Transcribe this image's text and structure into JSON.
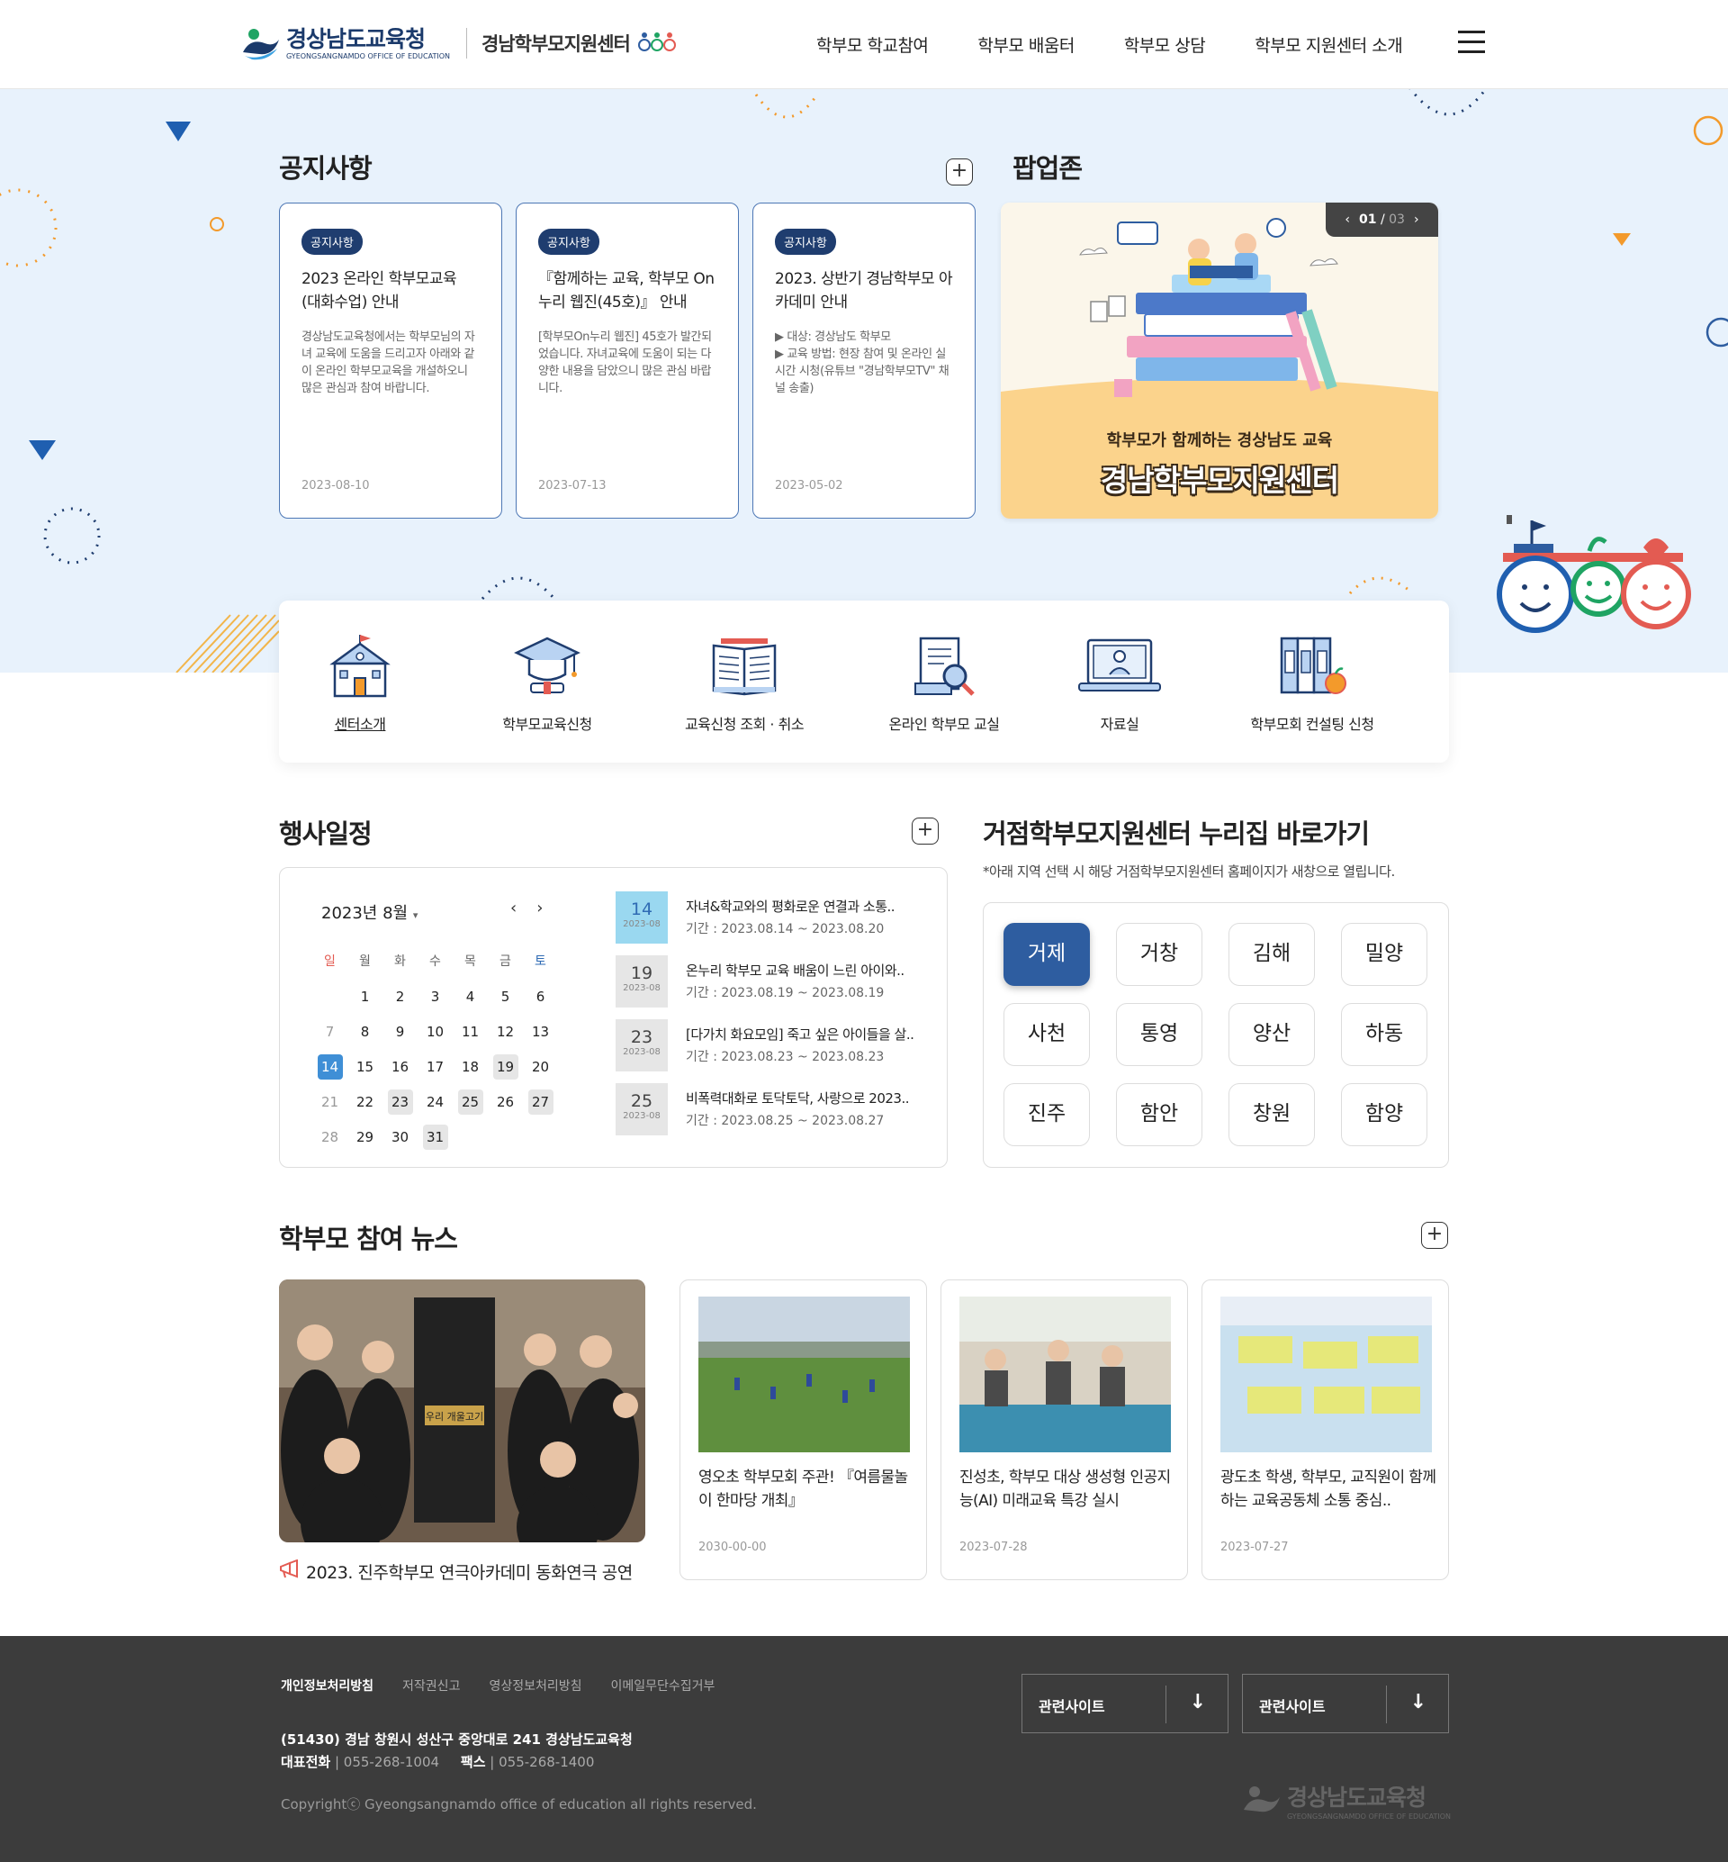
{
  "header": {
    "logo_ko": "경상남도교육청",
    "logo_en": "GYEONGSANGNAMDO OFFICE OF EDUCATION",
    "site_name": "경남학부모지원센터",
    "nav": [
      "학부모 학교참여",
      "학부모 배움터",
      "학부모 상담",
      "학부모 지원센터 소개"
    ],
    "menu_icon": "hamburger-icon"
  },
  "notice": {
    "title": "공지사항",
    "plus": "+",
    "cards": [
      {
        "badge": "공지사항",
        "title": "2023 온라인 학부모교육 (대화수업) 안내",
        "body": "경상남도교육청에서는 학부모님의 자녀 교육에 도움을 드리고자 아래와 같이 온라인 학부모교육을 개설하오니 많은 관심과 참여 바랍니다.",
        "date": "2023-08-10"
      },
      {
        "badge": "공지사항",
        "title": "『함께하는 교육, 학부모 On누리 웹진(45호)』 안내",
        "body": "[학부모On누리 웹진] 45호가 발간되었습니다. 자녀교육에 도움이 되는 다양한 내용을 담았으니 많은 관심 바랍니다.",
        "date": "2023-07-13"
      },
      {
        "badge": "공지사항",
        "title": "2023. 상반기 경남학부모 아카데미 안내",
        "body": "▶ 대상: 경상남도 학부모\n▶ 교육 방법: 현장 참여 및 온라인 실시간 시청(유튜브 \"경남학부모TV\" 채널 송출)",
        "date": "2023-05-02"
      }
    ]
  },
  "popup": {
    "title": "팝업존",
    "current": "01",
    "total": "03",
    "caption_small": "학부모가 함께하는 경상남도 교육",
    "caption_big": "경남학부모지원센터"
  },
  "quick_menu": [
    {
      "label": "센터소개",
      "icon": "school-building-icon"
    },
    {
      "label": "학부모교육신청",
      "icon": "graduation-cap-icon"
    },
    {
      "label": "교육신청 조회 · 취소",
      "icon": "open-book-icon"
    },
    {
      "label": "온라인 학부모 교실",
      "icon": "document-search-icon"
    },
    {
      "label": "자료실",
      "icon": "laptop-icon"
    },
    {
      "label": "학부모회 컨설팅 신청",
      "icon": "books-apple-icon"
    }
  ],
  "events": {
    "title": "행사일정",
    "plus": "+",
    "calendar": {
      "month_label": "2023년 8월",
      "dow": [
        "일",
        "월",
        "화",
        "수",
        "목",
        "금",
        "토"
      ],
      "weeks": [
        [
          "",
          "1",
          "2",
          "3",
          "4",
          "5",
          "6"
        ],
        [
          "7",
          "8",
          "9",
          "10",
          "11",
          "12",
          "13"
        ],
        [
          "14",
          "15",
          "16",
          "17",
          "18",
          "19",
          "20"
        ],
        [
          "21",
          "22",
          "23",
          "24",
          "25",
          "26",
          "27"
        ],
        [
          "28",
          "29",
          "30",
          "31",
          "",
          "",
          ""
        ]
      ],
      "today": "14",
      "event_days": [
        "19",
        "23",
        "25",
        "27",
        "31"
      ]
    },
    "list": [
      {
        "day": "14",
        "month": "2023-08",
        "title": "자녀&학교와의 평화로운 연결과 소통..",
        "period": "기간 : 2023.08.14 ~ 2023.08.20"
      },
      {
        "day": "19",
        "month": "2023-08",
        "title": "온누리 학부모 교육 배움이 느린 아이와..",
        "period": "기간 : 2023.08.19 ~ 2023.08.19"
      },
      {
        "day": "23",
        "month": "2023-08",
        "title": "[다가치 화요모임] 죽고 싶은 아이들을 살..",
        "period": "기간 : 2023.08.23 ~ 2023.08.23"
      },
      {
        "day": "25",
        "month": "2023-08",
        "title": "비폭력대화로 토닥토닥, 사랑으로 2023..",
        "period": "기간 : 2023.08.25 ~ 2023.08.27"
      }
    ]
  },
  "regions": {
    "title": "거점학부모지원센터 누리집 바로가기",
    "note": "*아래 지역 선택 시 해당 거점학부모지원센터 홈페이지가 새창으로 열립니다.",
    "items": [
      "거제",
      "거창",
      "김해",
      "밀양",
      "사천",
      "통영",
      "양산",
      "하동",
      "진주",
      "함안",
      "창원",
      "함양"
    ],
    "active": "거제"
  },
  "news": {
    "title": "학부모 참여 뉴스",
    "plus": "+",
    "main_caption": "2023. 진주학부모 연극아카데미 동화연극 공연",
    "main_poster": "우리 개울고기",
    "cards": [
      {
        "title": "영오초 학부모회 주관! 『여름물놀이 한마당 개최』",
        "date": "2030-00-00"
      },
      {
        "title": "진성초, 학부모 대상 생성형 인공지능(AI) 미래교육 특강 실시",
        "date": "2023-07-28"
      },
      {
        "title": "광도초 학생, 학부모, 교직원이 함께하는 교육공동체 소통 중심..",
        "date": "2023-07-27"
      }
    ]
  },
  "footer": {
    "links": [
      "개인정보처리방침",
      "저작권신고",
      "영상정보처리방침",
      "이메일무단수집거부"
    ],
    "address": "(51430) 경남 창원시 성산구 중앙대로 241 경상남도교육청",
    "tel_label": "대표전화",
    "tel": "055-268-1004",
    "fax_label": "팩스",
    "fax": "055-268-1400",
    "copyright": "Copyrightⓒ Gyeongsangnamdo office of education all rights reserved.",
    "related_1": "관련사이트",
    "related_2": "관련사이트",
    "logo_ko": "경상남도교육청",
    "logo_en": "GYEONGSANGNAMDO OFFICE OF EDUCATION"
  },
  "colors": {
    "primary": "#1f3d6f",
    "accent_blue": "#2e5da0",
    "bg_blue": "#e8f2fc",
    "footer": "#3c3c3c",
    "orange": "#f39a2b"
  }
}
